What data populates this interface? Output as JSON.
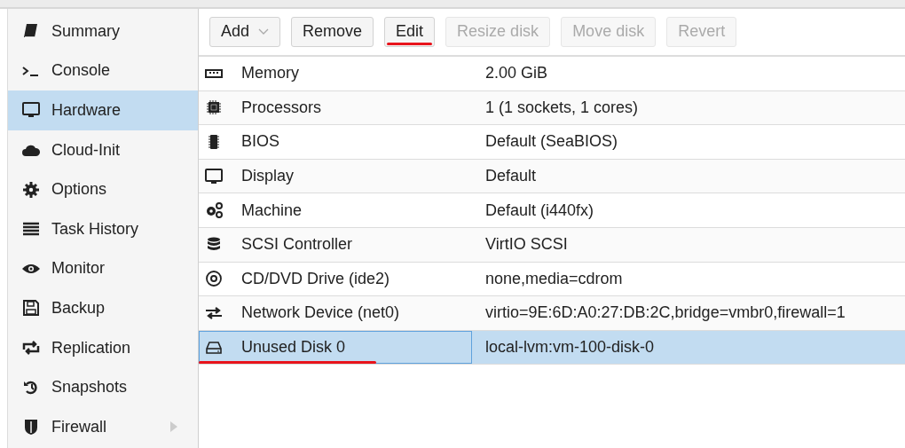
{
  "sidebar": {
    "items": [
      {
        "label": "Summary",
        "selected": false,
        "submenu": false
      },
      {
        "label": "Console",
        "selected": false,
        "submenu": false
      },
      {
        "label": "Hardware",
        "selected": true,
        "submenu": false
      },
      {
        "label": "Cloud-Init",
        "selected": false,
        "submenu": false
      },
      {
        "label": "Options",
        "selected": false,
        "submenu": false
      },
      {
        "label": "Task History",
        "selected": false,
        "submenu": false
      },
      {
        "label": "Monitor",
        "selected": false,
        "submenu": false
      },
      {
        "label": "Backup",
        "selected": false,
        "submenu": false
      },
      {
        "label": "Replication",
        "selected": false,
        "submenu": false
      },
      {
        "label": "Snapshots",
        "selected": false,
        "submenu": false
      },
      {
        "label": "Firewall",
        "selected": false,
        "submenu": true
      }
    ]
  },
  "toolbar": {
    "buttons": [
      {
        "label": "Add",
        "disabled": false,
        "dropdown": true,
        "underlined": false
      },
      {
        "label": "Remove",
        "disabled": false,
        "dropdown": false,
        "underlined": false
      },
      {
        "label": "Edit",
        "disabled": false,
        "dropdown": false,
        "underlined": true
      },
      {
        "label": "Resize disk",
        "disabled": true,
        "dropdown": false,
        "underlined": false
      },
      {
        "label": "Move disk",
        "disabled": true,
        "dropdown": false,
        "underlined": false
      },
      {
        "label": "Revert",
        "disabled": true,
        "dropdown": false,
        "underlined": false
      }
    ]
  },
  "table": {
    "rows": [
      {
        "name": "Memory",
        "value": "2.00 GiB",
        "selected": false,
        "underlined": false
      },
      {
        "name": "Processors",
        "value": "1 (1 sockets, 1 cores)",
        "selected": false,
        "underlined": false
      },
      {
        "name": "BIOS",
        "value": "Default (SeaBIOS)",
        "selected": false,
        "underlined": false
      },
      {
        "name": "Display",
        "value": "Default",
        "selected": false,
        "underlined": false
      },
      {
        "name": "Machine",
        "value": "Default (i440fx)",
        "selected": false,
        "underlined": false
      },
      {
        "name": "SCSI Controller",
        "value": "VirtIO SCSI",
        "selected": false,
        "underlined": false
      },
      {
        "name": "CD/DVD Drive (ide2)",
        "value": "none,media=cdrom",
        "selected": false,
        "underlined": false
      },
      {
        "name": "Network Device (net0)",
        "value": "virtio=9E:6D:A0:27:DB:2C,bridge=vmbr0,firewall=1",
        "selected": false,
        "underlined": false
      },
      {
        "name": "Unused Disk 0",
        "value": "local-lvm:vm-100-disk-0",
        "selected": true,
        "underlined": true
      }
    ]
  }
}
